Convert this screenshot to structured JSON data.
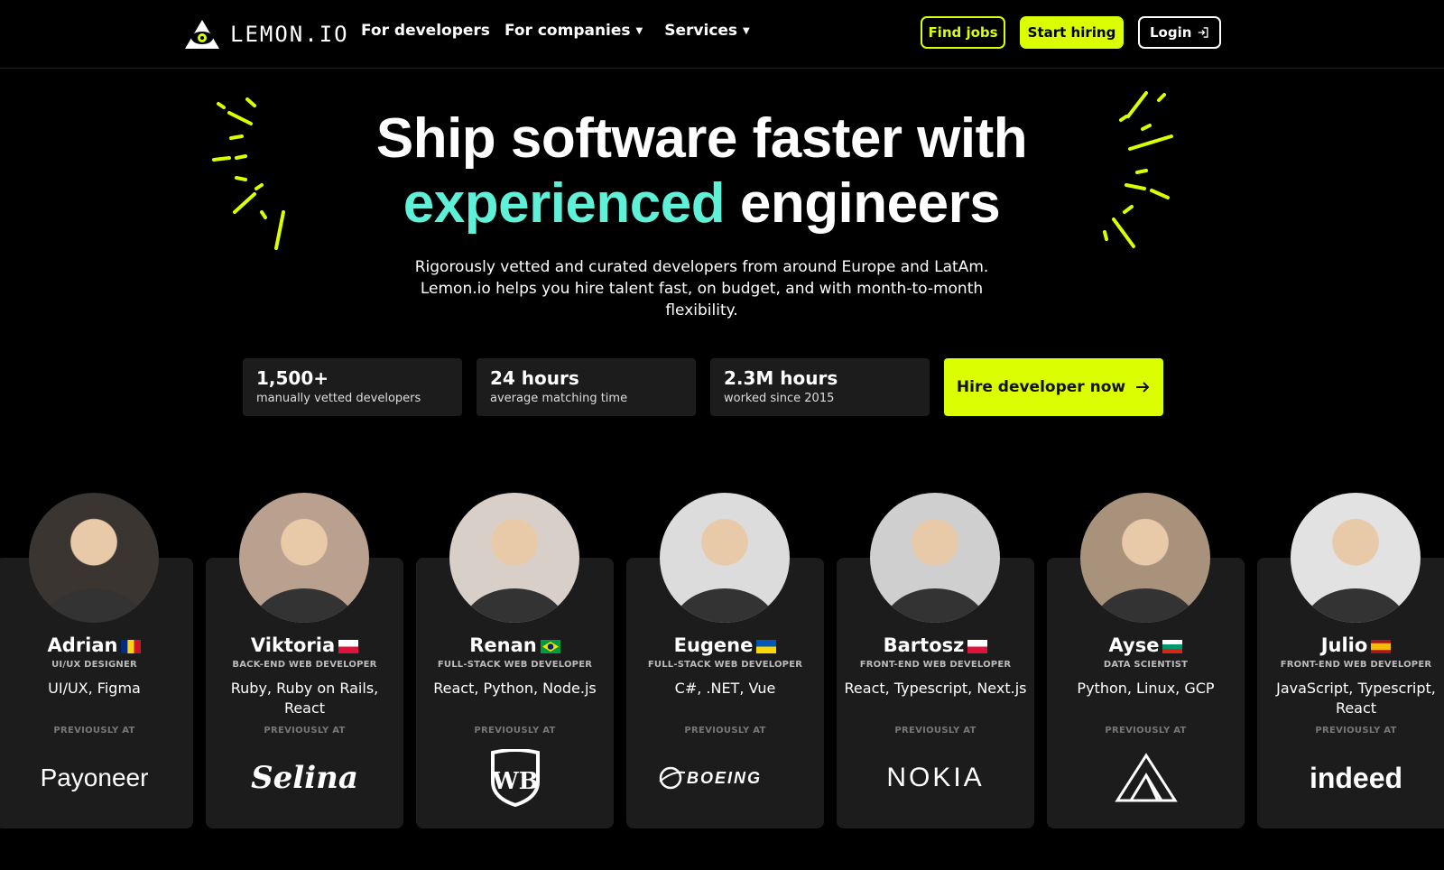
{
  "nav": {
    "logo_text": "LEMON.IO",
    "links": [
      {
        "label": "For developers",
        "has_dropdown": false
      },
      {
        "label": "For companies",
        "has_dropdown": true
      },
      {
        "label": "Services",
        "has_dropdown": true
      }
    ],
    "find_jobs": "Find jobs",
    "start_hiring": "Start hiring",
    "login": "Login"
  },
  "hero": {
    "title_line1": "Ship software faster with",
    "title_accent": "experienced",
    "title_end": " engineers",
    "subtitle": "Rigorously vetted and curated developers from around Europe and LatAm. Lemon.io helps you hire talent fast, on budget, and with month-to-month flexibility."
  },
  "stats": [
    {
      "value": "1,500+",
      "label": "manually vetted developers"
    },
    {
      "value": "24 hours",
      "label": "average matching time"
    },
    {
      "value": "2.3M hours",
      "label": "worked since 2015"
    }
  ],
  "cta": {
    "label": "Hire developer now"
  },
  "prev_label": "PREVIOUSLY AT",
  "developers": [
    {
      "name": "Adrian",
      "flag": "ro",
      "role": "UI/UX DESIGNER",
      "skills": "UI/UX, Figma",
      "company": "Payoneer",
      "avatar_color": "#3a3530"
    },
    {
      "name": "Viktoria",
      "flag": "pl",
      "role": "BACK-END WEB DEVELOPER",
      "skills": "Ruby, Ruby on Rails, React",
      "company": "Selina",
      "avatar_color": "#b9a08f"
    },
    {
      "name": "Renan",
      "flag": "br",
      "role": "FULL-STACK WEB DEVELOPER",
      "skills": "React, Python, Node.js",
      "company": "WB",
      "avatar_color": "#d8d0c8"
    },
    {
      "name": "Eugene",
      "flag": "ua",
      "role": "FULL-STACK WEB DEVELOPER",
      "skills": "C#, .NET, Vue",
      "company": "BOEING",
      "avatar_color": "#dcdcdc"
    },
    {
      "name": "Bartosz",
      "flag": "pl",
      "role": "FRONT-END WEB DEVELOPER",
      "skills": "React, Typescript, Next.js",
      "company": "NOKIA",
      "avatar_color": "#cfcfcf"
    },
    {
      "name": "Ayse",
      "flag": "bg",
      "role": "DATA SCIENTIST",
      "skills": "Python, Linux, GCP",
      "company": "Atlassian",
      "avatar_color": "#a8927c"
    },
    {
      "name": "Julio",
      "flag": "es",
      "role": "FRONT-END WEB DEVELOPER",
      "skills": "JavaScript, Typescript, React",
      "company": "indeed",
      "avatar_color": "#e2e2e2"
    }
  ]
}
